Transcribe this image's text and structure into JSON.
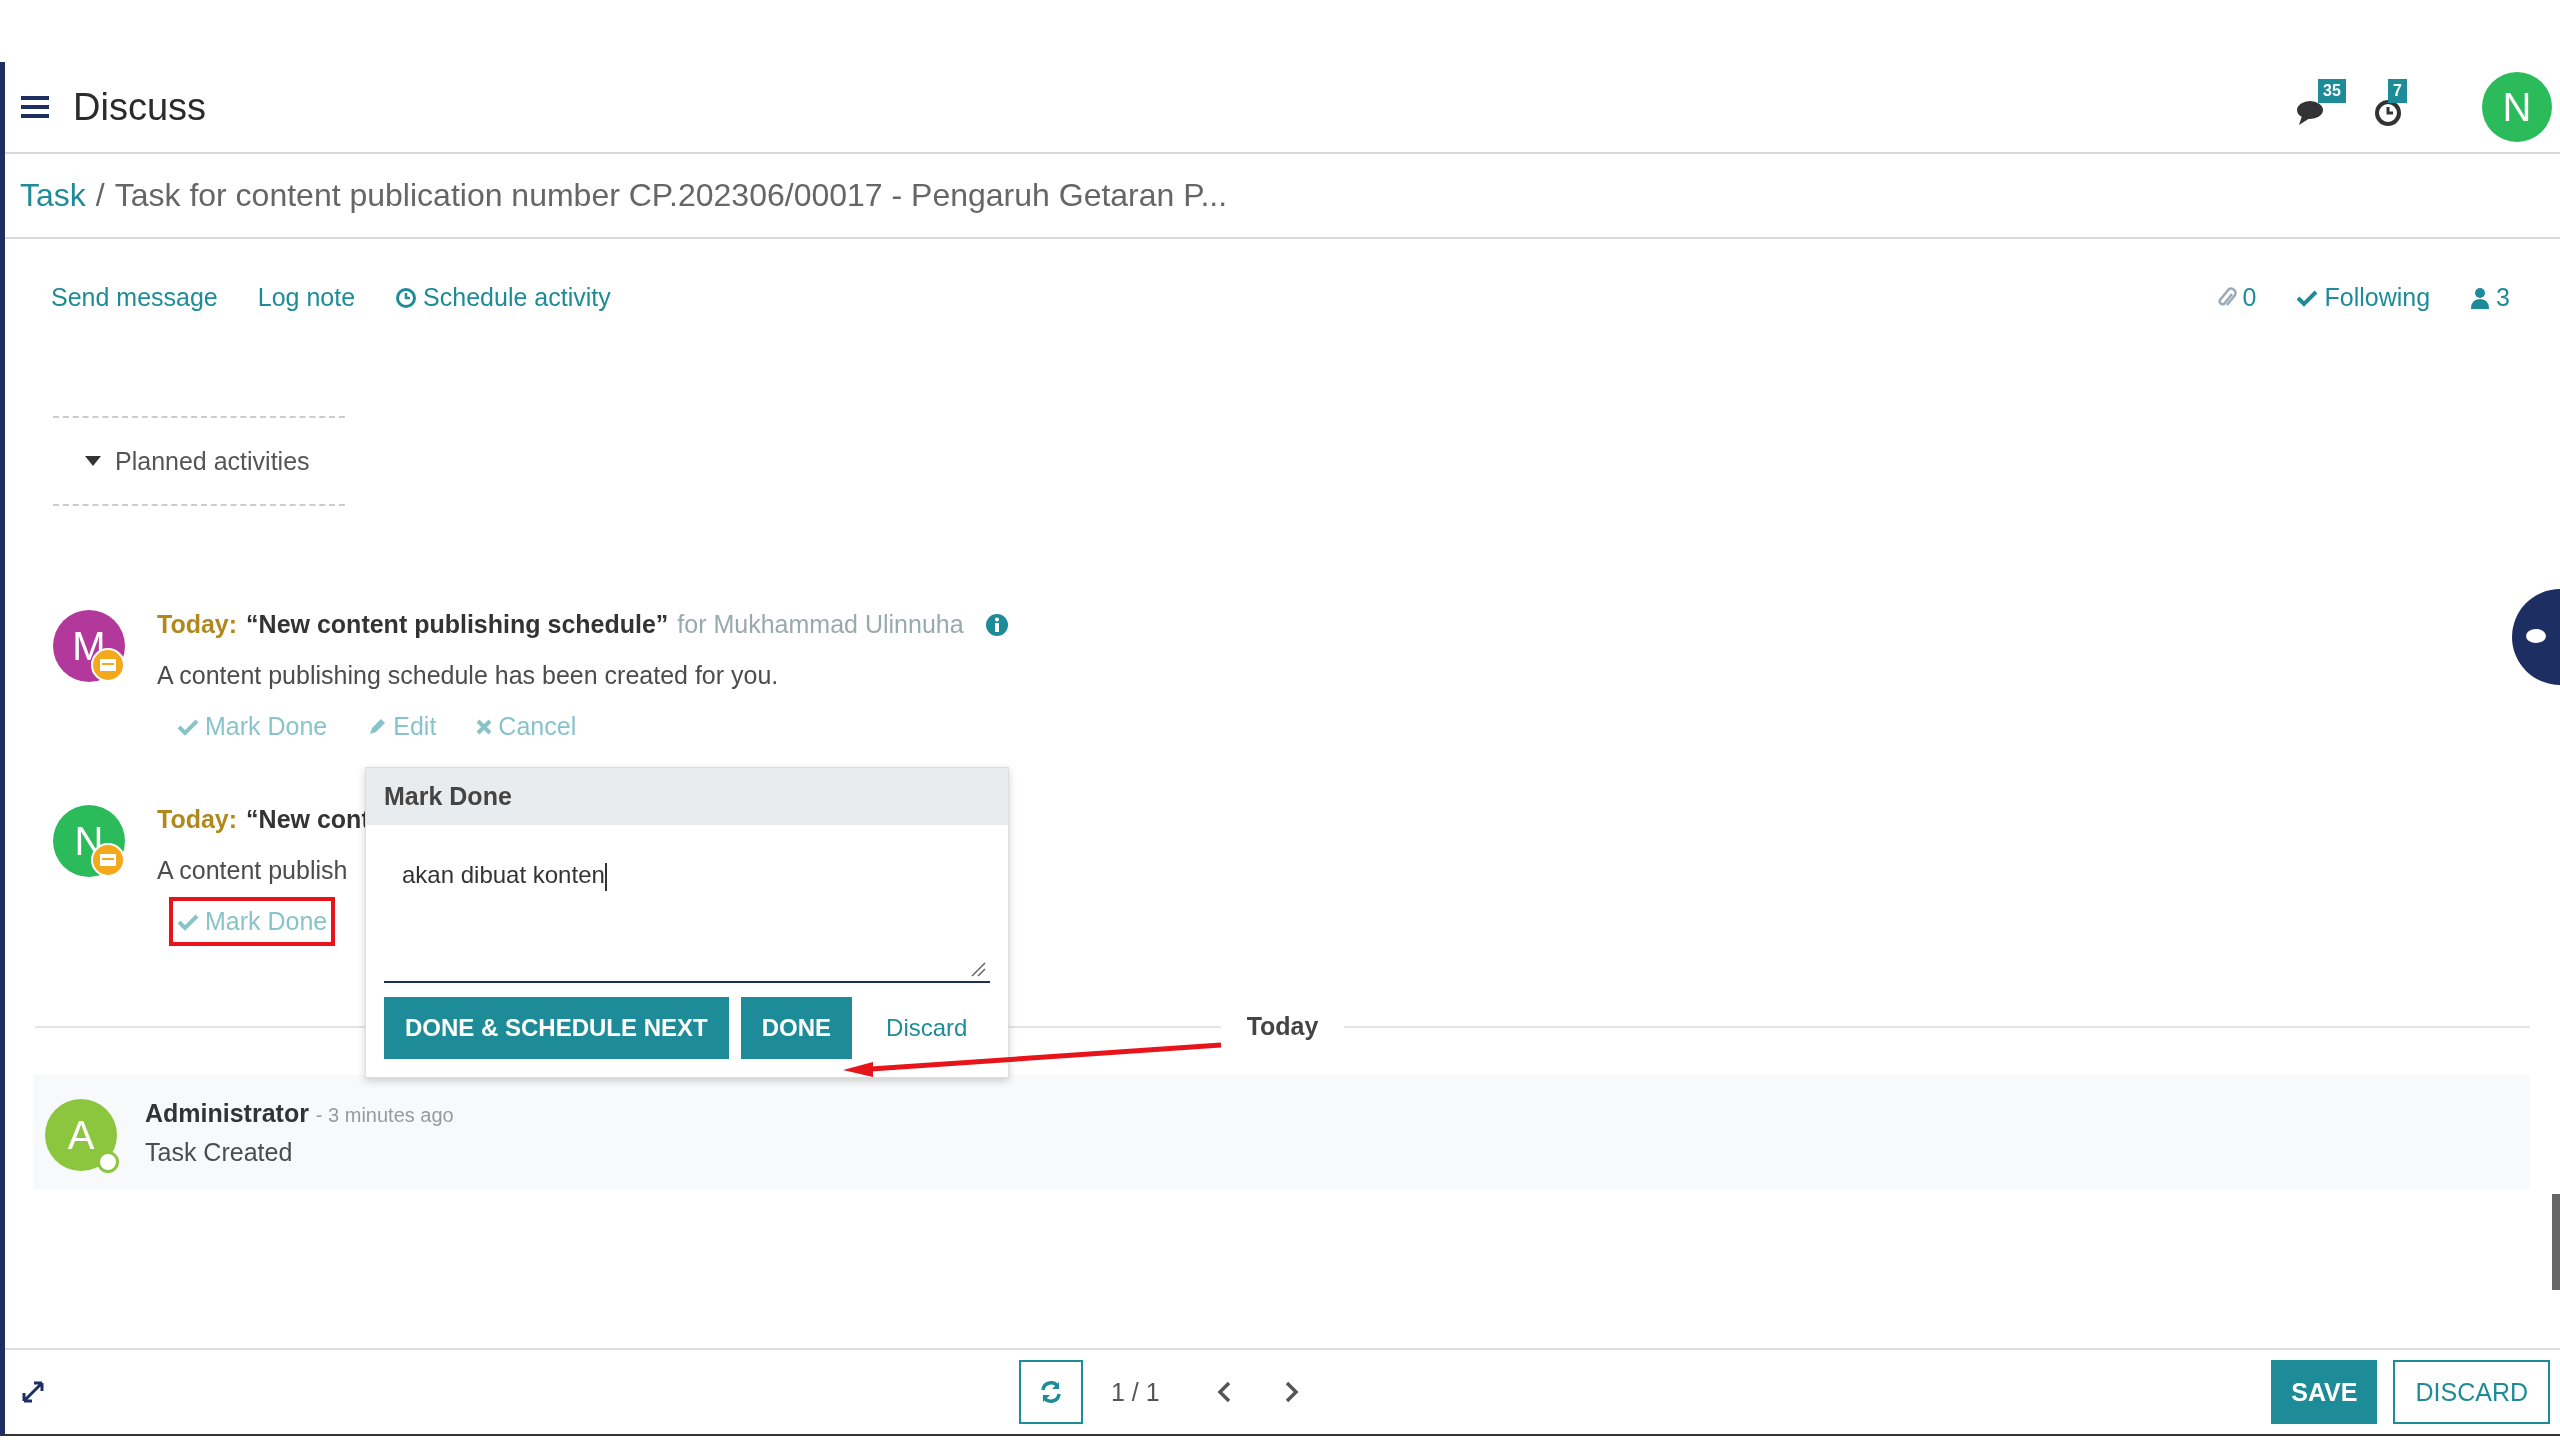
{
  "app": {
    "title": "Discuss",
    "messages_count": "35",
    "activities_count": "7",
    "user_initial": "N"
  },
  "breadcrumb": {
    "parent": "Task",
    "separator": "/",
    "current": "Task for content publication number CP.202306/00017 - Pengaruh Getaran P..."
  },
  "chatter_actions": [
    {
      "label": "Send message",
      "kind": "text"
    },
    {
      "label": "Log note",
      "kind": "text"
    },
    {
      "label": "Schedule activity",
      "kind": "clock"
    }
  ],
  "chatter_counters": {
    "attachments": "0",
    "follow": "Following",
    "followers": "3"
  },
  "planned": {
    "label": "Planned activities",
    "expanded": true
  },
  "activities": [
    {
      "avatar": "M",
      "color": "#b2399b",
      "due": "Today:",
      "title": "“New content publishing schedule”",
      "assignee": "for Mukhammad Ulinnuha",
      "info": true,
      "description": "A content publishing schedule has been created for you.",
      "actions": [
        {
          "label": "Mark Done",
          "kind": "done",
          "highlighted": false
        },
        {
          "label": "Edit",
          "kind": "edit",
          "highlighted": false
        },
        {
          "label": "Cancel",
          "kind": "cancel",
          "highlighted": false
        }
      ]
    },
    {
      "avatar": "N",
      "color": "#2cbb5b",
      "due": "Today:",
      "title": "“New cont",
      "info": false,
      "description": "A content publish",
      "actions": [
        {
          "label": "Mark Done",
          "kind": "done",
          "highlighted": true
        }
      ]
    }
  ],
  "popover": {
    "title": "Mark Done",
    "feedback": "akan dibuat konten",
    "buttons": [
      "DONE & SCHEDULE NEXT",
      "DONE"
    ],
    "link": "Discard"
  },
  "separator": "Today",
  "messages": [
    {
      "avatar": "A",
      "author": "Administrator",
      "time": "- 3 minutes ago",
      "body": "Task Created"
    }
  ],
  "pager": {
    "value": "1 / 1"
  },
  "form_buttons": [
    {
      "label": "SAVE",
      "kind": "primary"
    },
    {
      "label": "DISCARD",
      "kind": "secondary"
    }
  ]
}
